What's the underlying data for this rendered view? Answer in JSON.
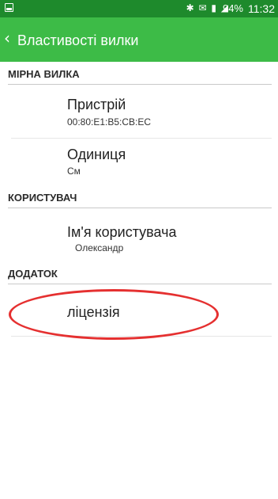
{
  "status_bar": {
    "icons": "✱ ✉ ▮ ◢",
    "battery": "94%",
    "time": "11:32"
  },
  "action_bar": {
    "back_icon": "‹",
    "title": "Властивості вилки"
  },
  "sections": {
    "fork": {
      "header": "МІРНА ВИЛКА",
      "device_title": "Пристрій",
      "device_summary": "00:80:E1:B5:CB:EC",
      "unit_title": "Одиниця",
      "unit_summary": "См"
    },
    "user": {
      "header": "КОРИСТУВАЧ",
      "username_title": "Ім'я користувача",
      "username_summary": "Олександр"
    },
    "app": {
      "header": "ДОДАТОК",
      "license_title": "ліцензія"
    }
  },
  "colors": {
    "status_bar": "#1e8a2c",
    "action_bar": "#3dbb47",
    "highlight": "#e53030"
  }
}
